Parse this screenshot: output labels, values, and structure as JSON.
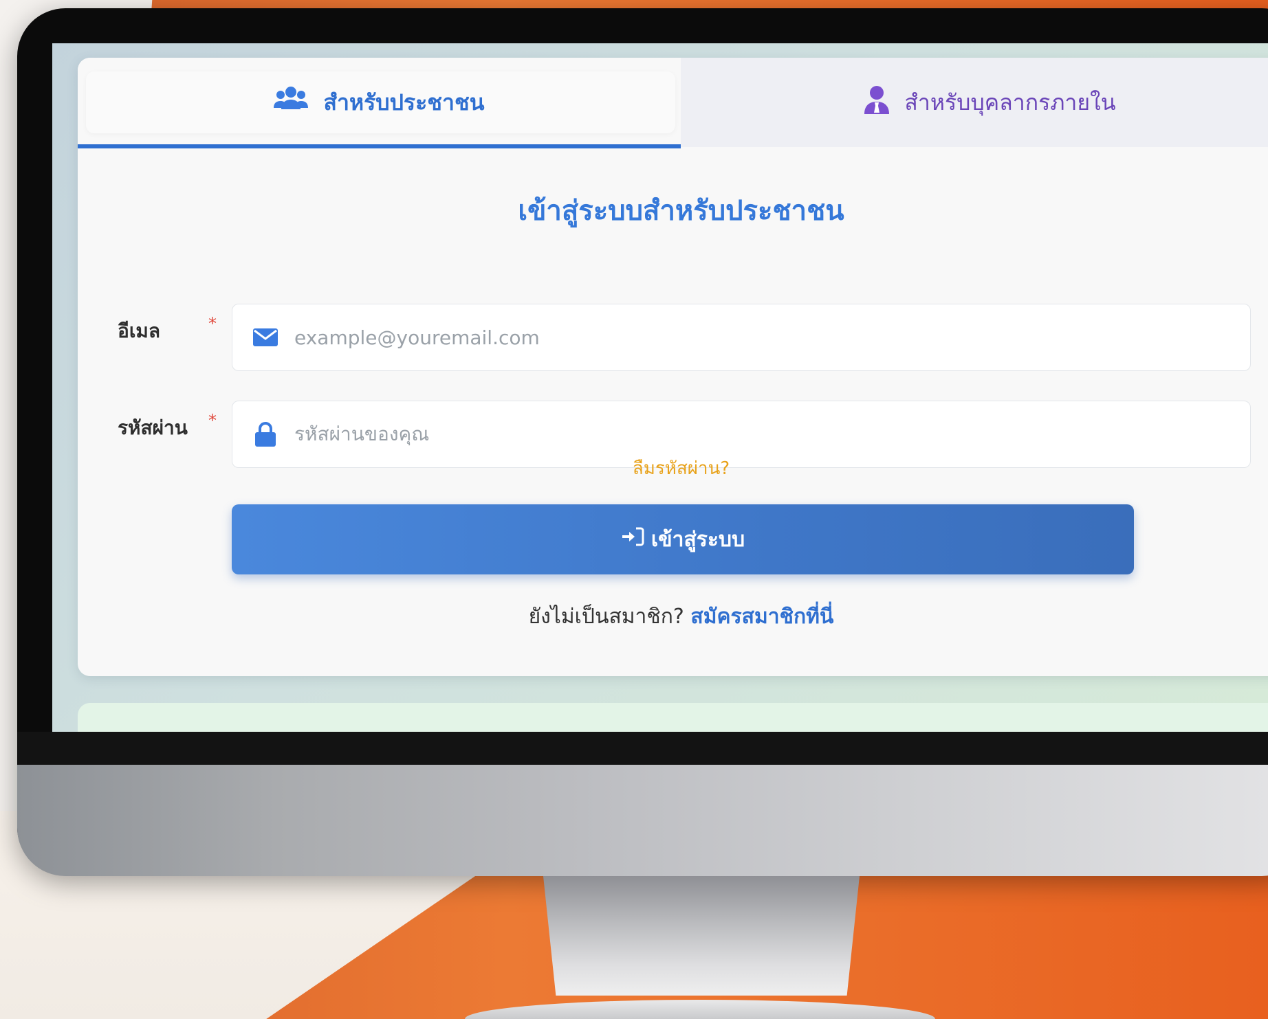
{
  "tabs": [
    {
      "label": "สำหรับประชาชน",
      "icon": "users-icon",
      "active": true
    },
    {
      "label": "สำหรับบุคลากรภายใน",
      "icon": "user-tie-icon",
      "active": false
    }
  ],
  "form": {
    "title": "เข้าสู่ระบบสำหรับประชาชน",
    "email": {
      "label": "อีเมล",
      "required_mark": "*",
      "placeholder": "example@youremail.com",
      "icon": "envelope-icon"
    },
    "password": {
      "label": "รหัสผ่าน",
      "required_mark": "*",
      "placeholder": "รหัสผ่านของคุณ",
      "icon": "lock-icon"
    },
    "forgot_label": "ลืมรหัสผ่าน?",
    "login_label": "เข้าสู่ระบบ",
    "signup_prompt": "ยังไม่เป็นสมาชิก?",
    "signup_link": "สมัครสมาชิกที่นี่"
  },
  "colors": {
    "primary_blue": "#2f6fd0",
    "staff_purple": "#6a45b8",
    "forgot_orange": "#e8a21a",
    "required_red": "#e0473a",
    "background_orange": "#ec7a34"
  }
}
